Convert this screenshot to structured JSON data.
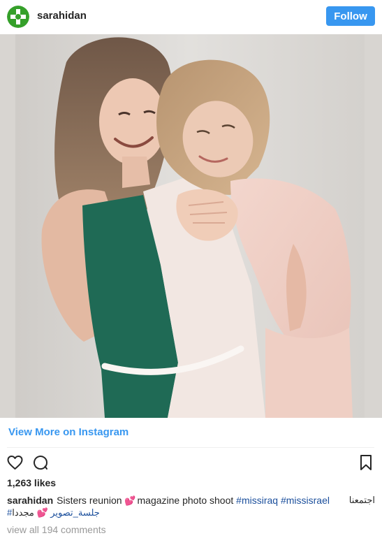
{
  "header": {
    "username": "sarahidan",
    "follow_label": "Follow",
    "avatar_colors": [
      "#35a02a",
      "#ffffff"
    ]
  },
  "links": {
    "view_more": "View More on Instagram"
  },
  "post": {
    "likes": "1,263 likes",
    "caption_user": "sarahidan",
    "caption_text_1": "Sisters reunion",
    "caption_text_2": "magazine photo shoot",
    "hashtag_1": "#missiraq",
    "hashtag_2": "#missisrael",
    "arabic_text_1": "اجتمعنا",
    "arabic_text_2": "مجددا",
    "arabic_hashtag": "#جلسة_تصوير",
    "hearts_emoji": "💕",
    "comments_link": "view all 194 comments"
  },
  "icons": [
    "heart-icon",
    "comment-icon",
    "bookmark-icon"
  ],
  "colors": {
    "accent": "#3897f0",
    "hashtag": "#1b4f9c",
    "muted": "#999999"
  }
}
